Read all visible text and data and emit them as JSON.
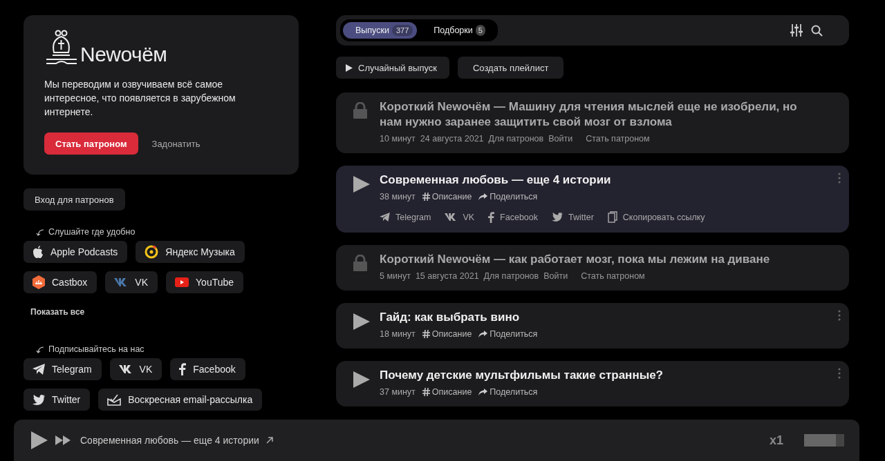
{
  "about": {
    "logo": "Newочём",
    "description": "Мы переводим и озвучиваем всё самое интересное, что появляется в зарубежном интернете.",
    "primary_button": "Стать патроном",
    "secondary_link": "Задонатить"
  },
  "login_button": "Вход для патронов",
  "listen": {
    "heading": "Слушайте где удобно",
    "platforms": [
      {
        "kind": "apple",
        "label": "Apple Podcasts"
      },
      {
        "kind": "yandex",
        "label": "Яндекс Музыка"
      },
      {
        "kind": "castbox",
        "label": "Castbox"
      },
      {
        "kind": "vk",
        "label": "VK"
      },
      {
        "kind": "youtube",
        "label": "YouTube"
      }
    ],
    "show_all": "Показать все"
  },
  "follow": {
    "heading": "Подписывайтесь на нас",
    "links": [
      {
        "kind": "telegram",
        "label": "Telegram"
      },
      {
        "kind": "vk",
        "label": "VK"
      },
      {
        "kind": "facebook",
        "label": "Facebook"
      },
      {
        "kind": "twitter",
        "label": "Twitter"
      },
      {
        "kind": "email",
        "label": "Воскресная email-рассылка"
      }
    ]
  },
  "tabs": [
    {
      "label": "Выпуски",
      "count": "377",
      "selected": true
    },
    {
      "label": "Подборки",
      "count": "5",
      "selected": false
    }
  ],
  "actions": [
    {
      "kind": "play",
      "label": "Случайный выпуск"
    },
    {
      "kind": "plain",
      "label": "Создать плейлист"
    }
  ],
  "episodes": [
    {
      "kind": "locked",
      "title": "Короткий Newочём — Машину для чтения мыслей еще не изобрели, но нам нужно заранее защитить свой мозг от взлома",
      "duration": "10 минут",
      "date": "24 августа 2021",
      "access": "Для патронов",
      "login": "Войти",
      "become": "Стать патроном"
    },
    {
      "kind": "playable",
      "title": "Современная любовь — еще 4 истории",
      "duration": "38 минут",
      "description": "Описание",
      "share": "Поделиться",
      "expanded": true,
      "share_links": [
        {
          "kind": "telegram",
          "label": "Telegram"
        },
        {
          "kind": "vk",
          "label": "VK"
        },
        {
          "kind": "facebook",
          "label": "Facebook"
        },
        {
          "kind": "twitter",
          "label": "Twitter"
        },
        {
          "kind": "copy",
          "label": "Скопировать ссылку"
        }
      ]
    },
    {
      "kind": "locked",
      "title": "Короткий Newочём — как работает мозг, пока мы лежим на диване",
      "duration": "5 минут",
      "date": "15 августа 2021",
      "access": "Для патронов",
      "login": "Войти",
      "become": "Стать патроном"
    },
    {
      "kind": "playable",
      "title": "Гайд: как выбрать вино",
      "duration": "18 минут",
      "description": "Описание",
      "share": "Поделиться",
      "expanded": false
    },
    {
      "kind": "playable",
      "title": "Почему детские мультфильмы такие странные?",
      "duration": "37 минут",
      "description": "Описание",
      "share": "Поделиться",
      "expanded": false
    }
  ],
  "player": {
    "title": "Современная любовь — еще 4 истории",
    "speed": "x1",
    "level": 0.8
  }
}
